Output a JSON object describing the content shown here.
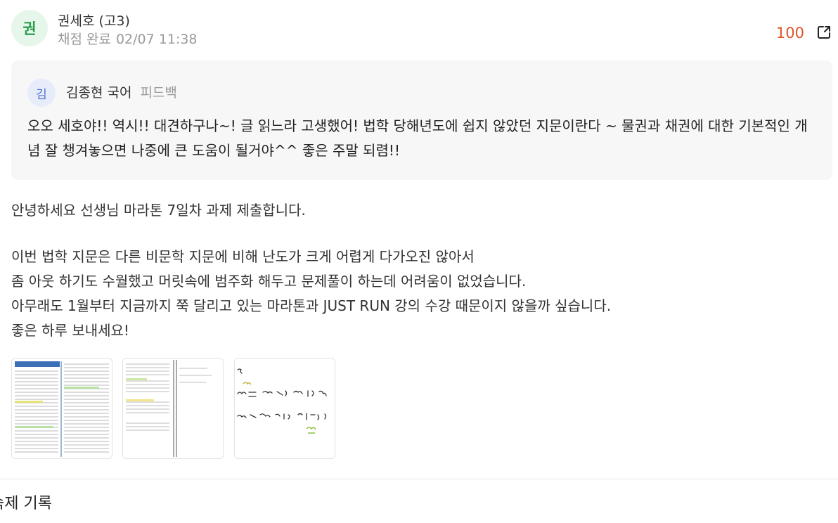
{
  "author": {
    "avatar_char": "권",
    "name": "권세호 (고3)",
    "status": "채점 완료",
    "datetime": "02/07 11:38"
  },
  "score": "100",
  "feedback": {
    "avatar_char": "김",
    "teacher": "김종현 국어",
    "tag": "피드백",
    "text": "오오 세호야!! 역시!! 대견하구나~! 글 읽느라 고생했어! 법학 당해년도에 쉽지 않았던 지문이란다 ~ 물권과 채권에 대한 기본적인 개념 잘 챙겨놓으면 나중에 큰 도움이 될거야^^ 좋은 주말 되렴!!"
  },
  "post": {
    "greeting": "안녕하세요 선생님 마라톤 7일차 과제 제출합니다.",
    "line1": "이번 법학 지문은 다른 비문학 지문에 비해 난도가 크게 어렵게 다가오진 않아서",
    "line2": "좀 아웃 하기도 수월했고 머릿속에 범주화 해두고 문제풀이 하는데 어려움이 없었습니다.",
    "line3": "아무래도 1월부터 지금까지 쭉 달리고 있는 마라톤과 JUST RUN 강의 수강 때문이지 않을까 싶습니다.",
    "line4": "좋은 하루 보내세요!"
  },
  "attachments": [
    "attachment-1",
    "attachment-2",
    "attachment-3"
  ],
  "section_title": "숙제 기록",
  "icons": {
    "share": "share-external-icon"
  },
  "colors": {
    "score": "#e0542a",
    "avatar_bg": "#e6f6ea",
    "avatar_fg": "#2e9c4e",
    "feedback_bg": "#f7f7f8"
  }
}
